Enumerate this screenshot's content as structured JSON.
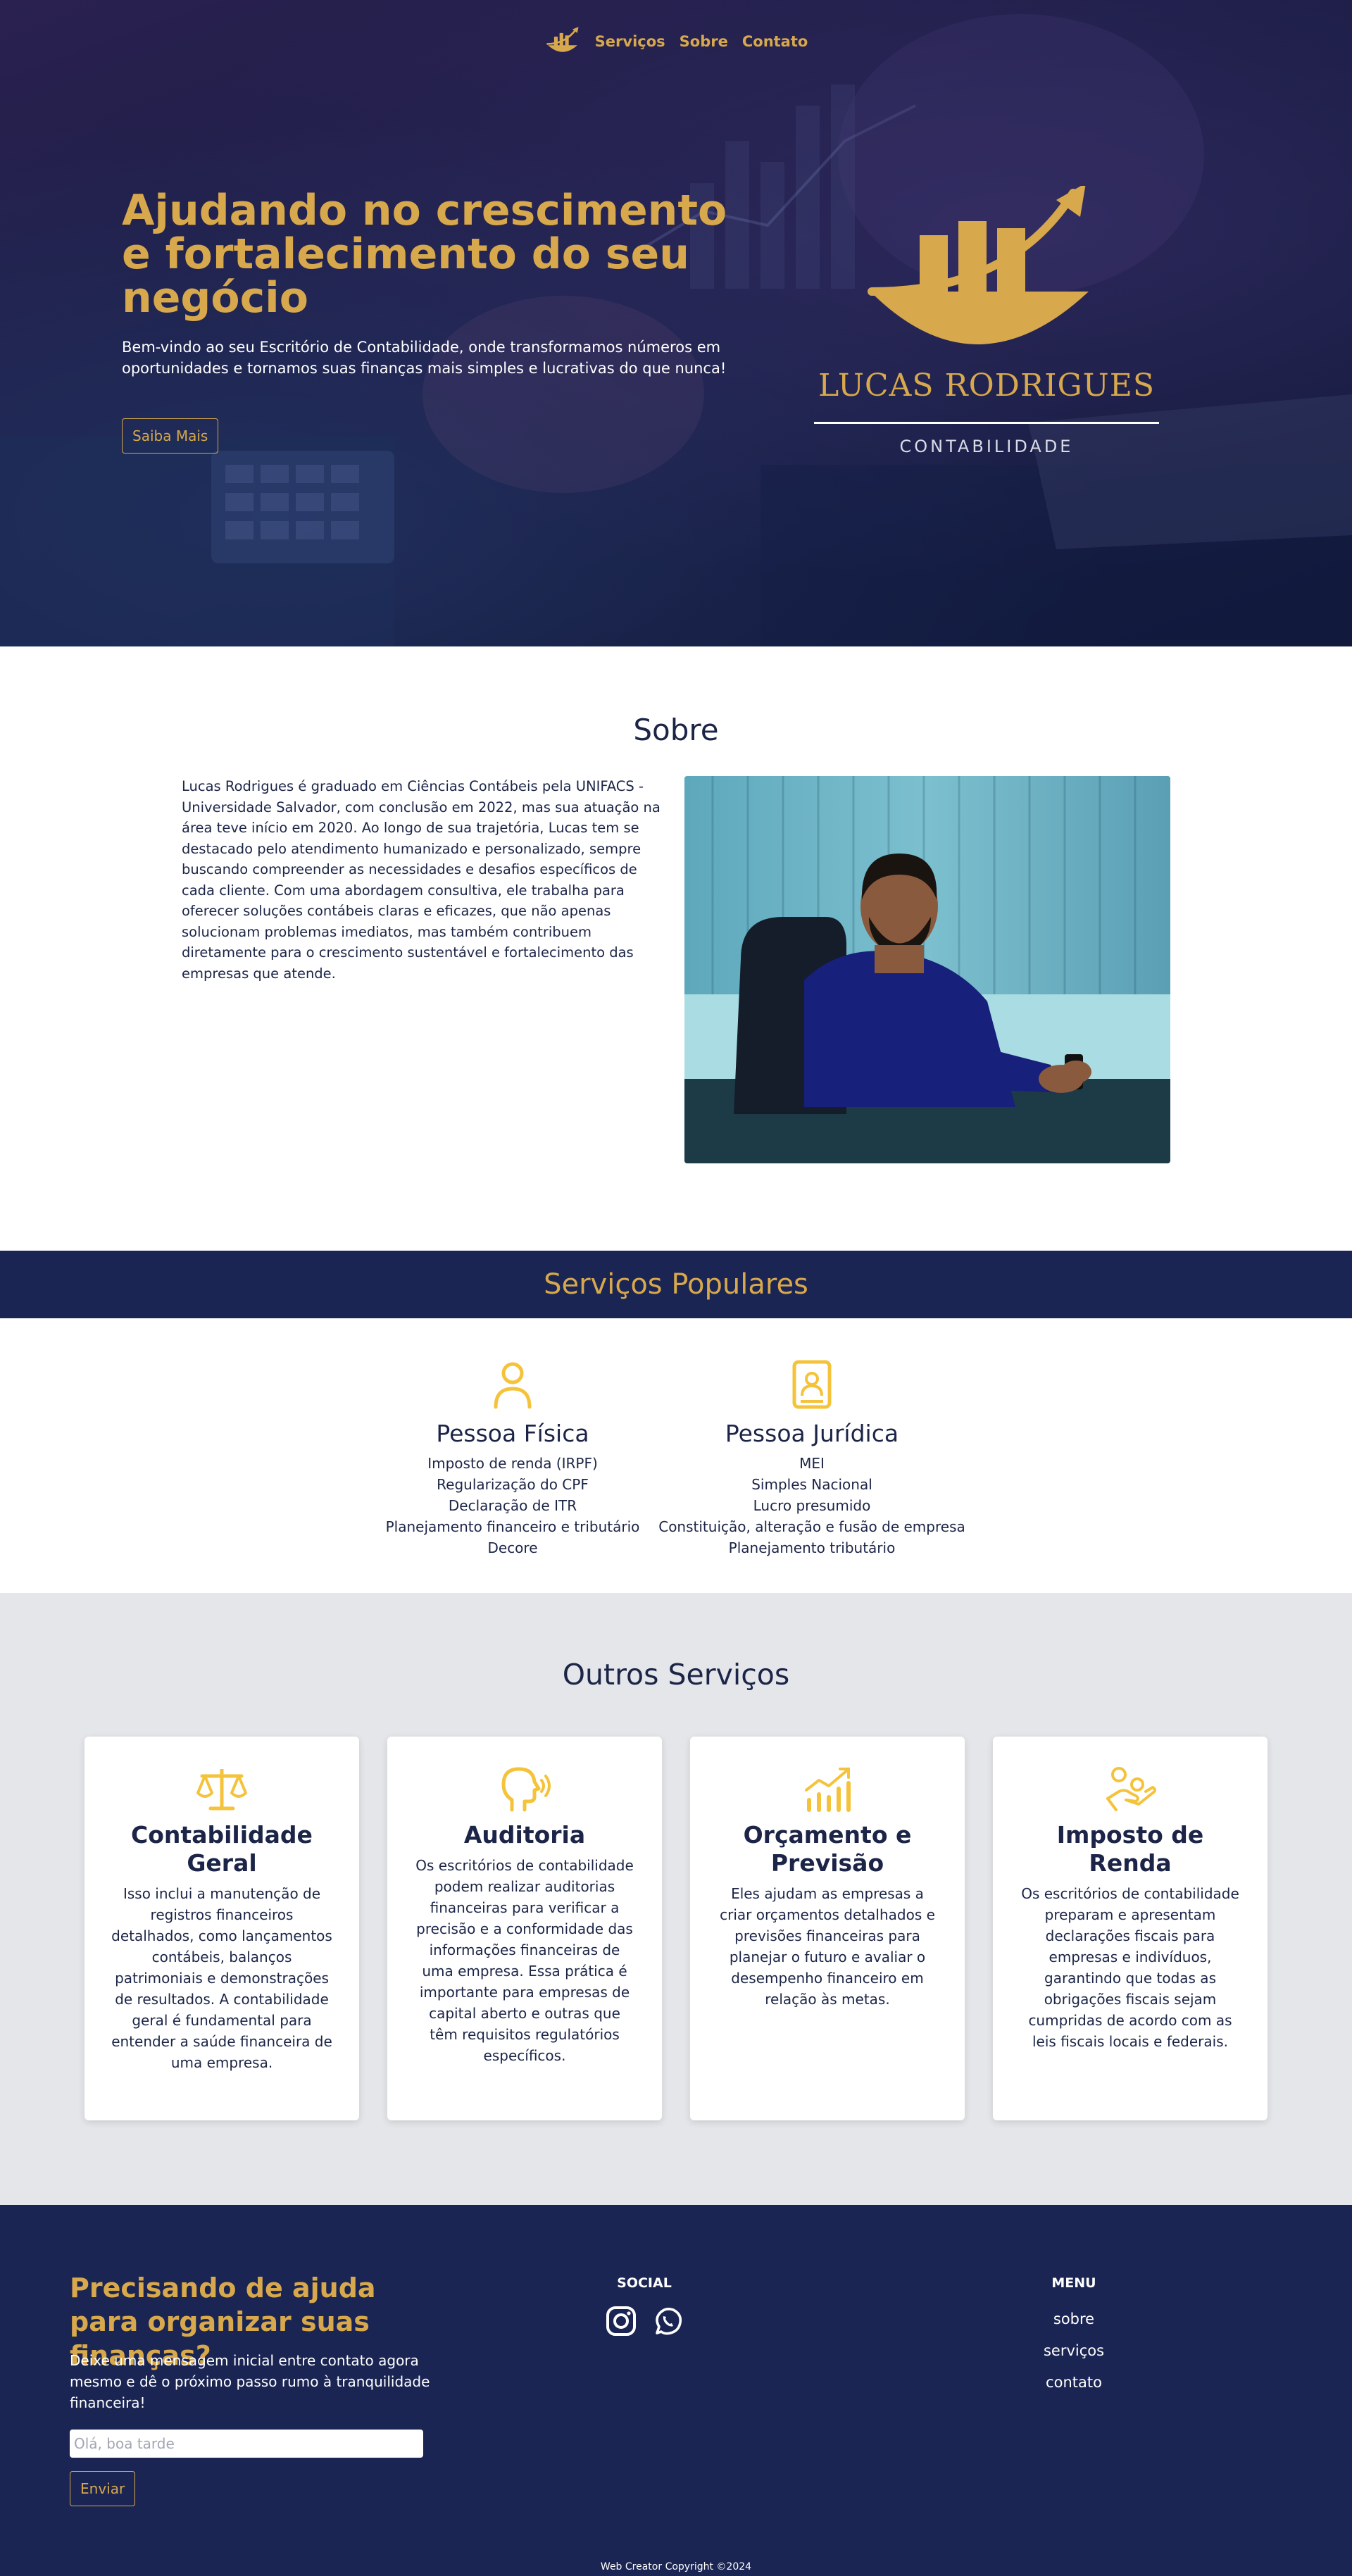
{
  "nav": {
    "items": [
      {
        "label": "Serviços"
      },
      {
        "label": "Sobre"
      },
      {
        "label": "Contato"
      }
    ]
  },
  "hero": {
    "title": "Ajudando no crescimento e fortalecimento do seu negócio",
    "subtitle": "Bem-vindo ao seu Escritório de Contabilidade, onde transformamos números em oportunidades e tornamos suas finanças mais simples e lucrativas do que nunca!",
    "button_label": "Saiba Mais",
    "brand_name": "LUCAS RODRIGUES",
    "brand_sub": "CONTABILIDADE"
  },
  "about": {
    "title": "Sobre",
    "text": "Lucas Rodrigues é graduado em Ciências Contábeis pela UNIFACS - Universidade Salvador, com conclusão em 2022, mas sua atuação na área teve início em 2020. Ao longo de sua trajetória, Lucas tem se destacado pelo atendimento humanizado e personalizado, sempre buscando compreender as necessidades e desafios específicos de cada cliente. Com uma abordagem consultiva, ele trabalha para oferecer soluções contábeis claras e eficazes, que não apenas solucionam problemas imediatos, mas também contribuem diretamente para o crescimento sustentável e fortalecimento das empresas que atende."
  },
  "popular": {
    "title": "Serviços Populares",
    "pf": {
      "title": "Pessoa Física",
      "icon": "person-icon",
      "items": [
        "Imposto de renda (IRPF)",
        "Regularização do CPF",
        "Declaração de ITR",
        "Planejamento financeiro e tributário",
        "Decore"
      ]
    },
    "pj": {
      "title": "Pessoa Jurídica",
      "icon": "id-card-icon",
      "items": [
        "MEI",
        "Simples Nacional",
        "Lucro presumido",
        "Constituição, alteração e fusão de empresa",
        "Planejamento tributário"
      ]
    }
  },
  "others": {
    "title": "Outros Serviços",
    "cards": [
      {
        "icon": "scale-icon",
        "title": "Contabilidade Geral",
        "text": "Isso inclui a manutenção de registros financeiros detalhados, como lançamentos contábeis, balanços patrimoniais e demonstrações de resultados. A contabilidade geral é fundamental para entender a saúde financeira de uma empresa."
      },
      {
        "icon": "speaking-head-icon",
        "title": "Auditoria",
        "text": "Os escritórios de contabilidade podem realizar auditorias financeiras para verificar a precisão e a conformidade das informações financeiras de uma empresa. Essa prática é importante para empresas de capital aberto e outras que têm requisitos regulatórios específicos."
      },
      {
        "icon": "growth-chart-icon",
        "title": "Orçamento e Previsão",
        "text": "Eles ajudam as empresas a criar orçamentos detalhados e previsões financeiras para planejar o futuro e avaliar o desempenho financeiro em relação às metas."
      },
      {
        "icon": "hand-money-icon",
        "title": "Imposto de Renda",
        "text": "Os escritórios de contabilidade preparam e apresentam declarações fiscais para empresas e indivíduos, garantindo que todas as obrigações fiscais sejam cumpridas de acordo com as leis fiscais locais e federais."
      }
    ]
  },
  "footer": {
    "title": "Precisando de ajuda para organizar suas finanças?",
    "text": "Deixe uma mensagem inicial entre contato agora mesmo e dê o próximo passo rumo à tranquilidade financeira!",
    "input_placeholder": "Olá, boa tarde",
    "send_label": "Enviar",
    "social_heading": "SOCIAL",
    "social_icons": [
      "instagram-icon",
      "whatsapp-icon"
    ],
    "menu_heading": "MENU",
    "menu": [
      {
        "label": "sobre"
      },
      {
        "label": "serviços"
      },
      {
        "label": "contato"
      }
    ],
    "copyright": "Web Creator Copyright ©2024"
  },
  "colors": {
    "navy": "#1a2553",
    "gold": "#d7a84c",
    "icon_yellow": "#f5c33b",
    "light_gray": "#e4e6ea"
  }
}
